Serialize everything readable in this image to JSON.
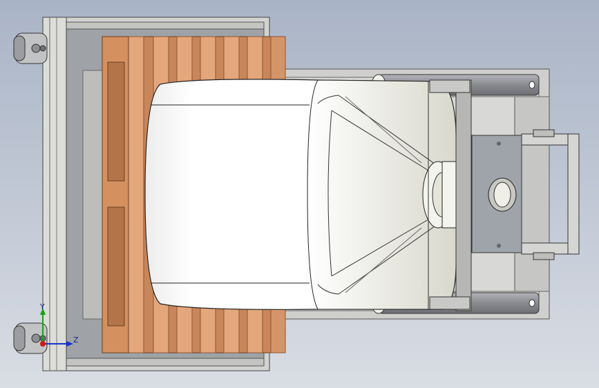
{
  "viewport": {
    "background_top": "#a9b4c6",
    "background_bottom": "#d9dde4"
  },
  "model": {
    "frame_color": "#c8c9c6",
    "frame_dark": "#7a7b7a",
    "pallet_color": "#c8865a",
    "pallet_light": "#e0a57a",
    "bag_color": "#ffffff",
    "roller_color": "#8e8f94",
    "steel_plate_color": "#9fa3aa"
  },
  "triad": {
    "y_label": "Y",
    "z_label": "Z",
    "x_color": "#d01818",
    "y_color": "#18a018",
    "z_color": "#1830d0"
  }
}
